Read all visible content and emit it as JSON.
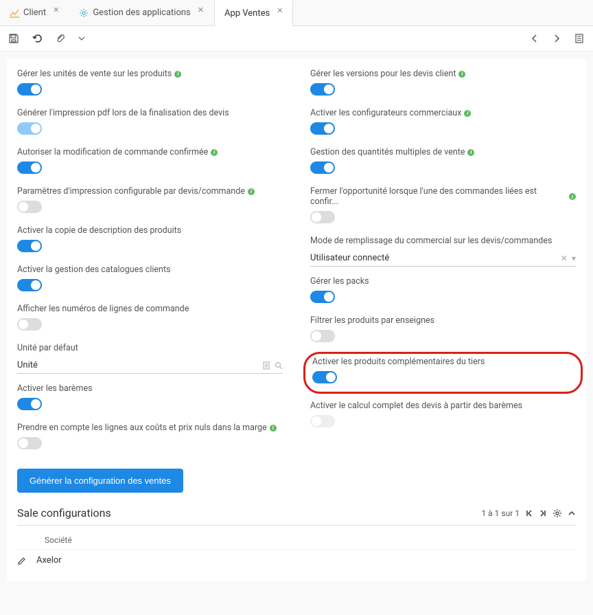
{
  "tabs": [
    {
      "label": "Client",
      "icon": "chart"
    },
    {
      "label": "Gestion des applications",
      "icon": "gear"
    },
    {
      "label": "App Ventes",
      "icon": null,
      "active": true
    }
  ],
  "left": {
    "f0": {
      "label": "Gérer les unités de vente sur les produits",
      "info": true,
      "on": true
    },
    "f1": {
      "label": "Générer l'impression pdf lors de la finalisation des devis",
      "info": false,
      "on": true,
      "disabled": true
    },
    "f2": {
      "label": "Autoriser la modification de commande confirmée",
      "info": true,
      "on": true
    },
    "f3": {
      "label": "Paramètres d'impression configurable par devis/commande",
      "info": true,
      "on": false
    },
    "f4": {
      "label": "Activer la copie de description des produits",
      "info": false,
      "on": true
    },
    "f5": {
      "label": "Activer la gestion des catalogues clients",
      "info": false,
      "on": true
    },
    "f6": {
      "label": "Afficher les numéros de lignes de commande",
      "info": false,
      "on": false
    },
    "unit": {
      "label": "Unité par défaut",
      "value": "Unité"
    },
    "f7": {
      "label": "Activer les barèmes",
      "info": false,
      "on": true
    },
    "f8": {
      "label": "Prendre en compte les lignes aux coûts et prix nuls dans la marge",
      "info": true,
      "on": false
    }
  },
  "right": {
    "f0": {
      "label": "Gérer les versions pour les devis client",
      "info": true,
      "on": true
    },
    "f1": {
      "label": "Activer les configurateurs commerciaux",
      "info": true,
      "on": true
    },
    "f2": {
      "label": "Gestion des quantités multiples de vente",
      "info": true,
      "on": true
    },
    "f3": {
      "label": "Fermer l'opportunité lorsque l'une des commandes liées est confir...",
      "info": true,
      "on": false
    },
    "mode": {
      "label": "Mode de remplissage du commercial sur les devis/commandes",
      "value": "Utilisateur connecté"
    },
    "f4": {
      "label": "Gérer les packs",
      "info": false,
      "on": true
    },
    "f5": {
      "label": "Filtrer les produits par enseignes",
      "info": false,
      "on": false
    },
    "f6": {
      "label": "Activer les produits complémentaires du tiers",
      "info": false,
      "on": true,
      "highlighted": true
    },
    "f7": {
      "label": "Activer le calcul complet des devis à partir des barèmes",
      "info": false,
      "on": false,
      "disabled": true
    }
  },
  "button": {
    "generate": "Générer la configuration des ventes"
  },
  "saleConfig": {
    "title": "Sale configurations",
    "pager": "1 à 1 sur 1",
    "columns": {
      "company": "Société"
    },
    "rows": [
      {
        "company": "Axelor"
      }
    ]
  }
}
